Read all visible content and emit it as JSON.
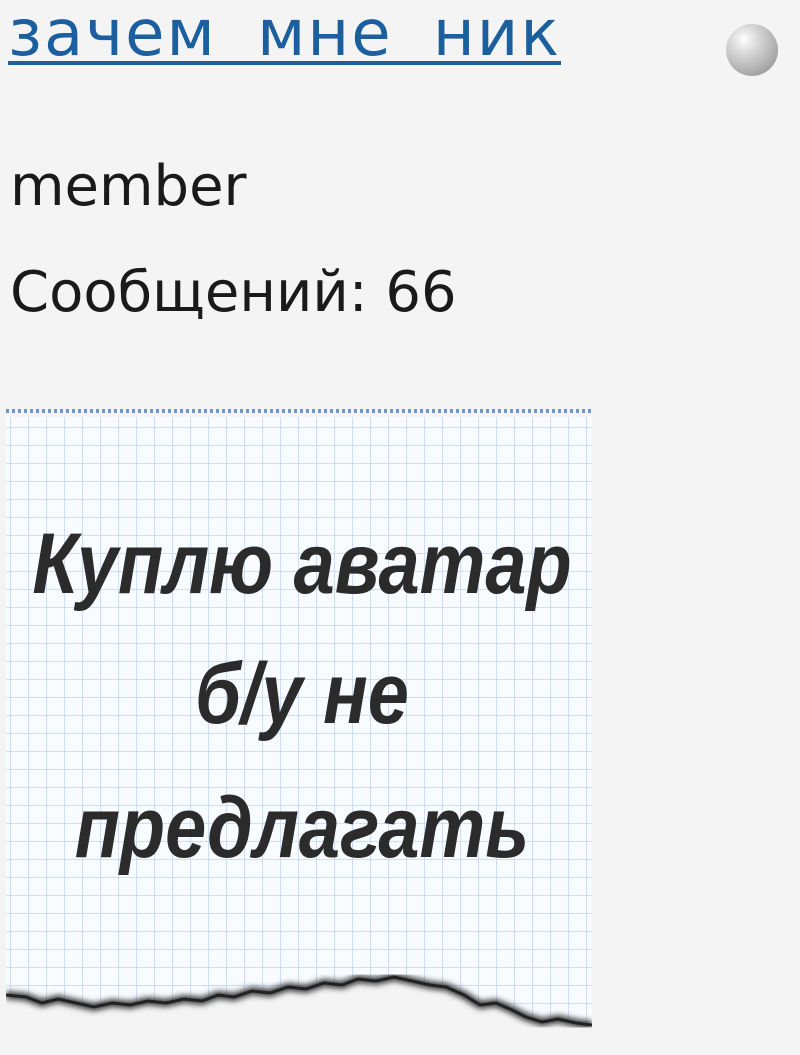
{
  "user": {
    "name": "зачем мне ник",
    "status": "offline",
    "rank": "member",
    "posts_label": "Сообщений: 66",
    "avatar_text": "Куплю аватар б/у не предлагать",
    "avatar_lines": [
      "Куплю аватар",
      "б/у не",
      "предлагать"
    ]
  },
  "colors": {
    "link": "#1b5f9e",
    "background": "#f4f4f4",
    "grid": "#bcd3f5",
    "text": "#1a1a1a"
  }
}
